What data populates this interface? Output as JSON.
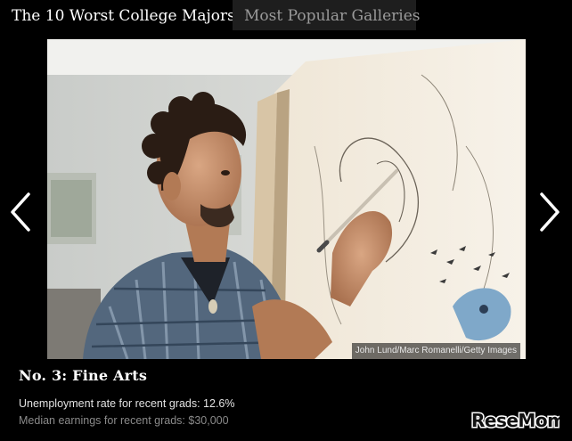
{
  "tabs": [
    {
      "label": "The 10 Worst College Majors",
      "active": true
    },
    {
      "label": "Most Popular Galleries",
      "active": false
    }
  ],
  "slide": {
    "image_credit": "John Lund/Marc Romanelli/Getty Images",
    "title": "No. 3: Fine Arts",
    "stat_unemployment": "Unemployment rate for recent grads: 12.6%",
    "stat_earnings": "Median earnings for recent grads: $30,000"
  },
  "navigation": {
    "prev_icon": "chevron-left-icon",
    "next_icon": "chevron-right-icon"
  },
  "watermark": {
    "text": "ReseMom"
  },
  "colors": {
    "background": "#000000",
    "inactive_tab": "#1e1e1e",
    "inactive_tab_text": "#9a9a9a",
    "caption_secondary": "#8a8a8a"
  }
}
